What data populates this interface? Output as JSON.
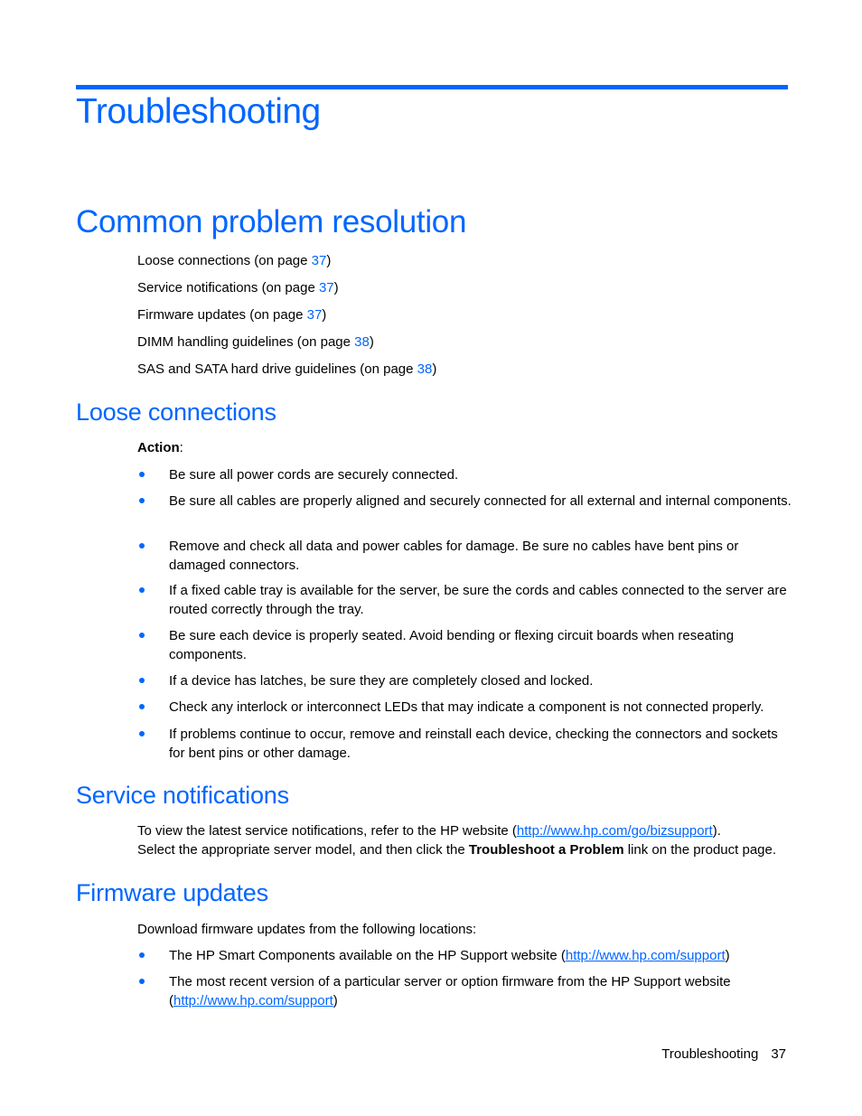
{
  "chapter": {
    "title": "Troubleshooting",
    "accent_color": "#0066ff"
  },
  "section": {
    "title": "Common problem resolution",
    "toc": [
      {
        "label": "Loose connections (on page ",
        "page": "37",
        "suffix": ")"
      },
      {
        "label": "Service notifications (on page ",
        "page": "37",
        "suffix": ")"
      },
      {
        "label": "Firmware updates (on page ",
        "page": "37",
        "suffix": ")"
      },
      {
        "label": "DIMM handling guidelines (on page ",
        "page": "38",
        "suffix": ")"
      },
      {
        "label": "SAS and SATA hard drive guidelines (on page ",
        "page": "38",
        "suffix": ")"
      }
    ]
  },
  "loose_connections": {
    "title": "Loose connections",
    "action_label": "Action",
    "action_colon": ":",
    "bullets": [
      "Be sure all power cords are securely connected.",
      "Be sure all cables are properly aligned and securely connected for all external and internal components.",
      "Remove and check all data and power cables for damage. Be sure no cables have bent pins or damaged connectors.",
      "If a fixed cable tray is available for the server, be sure the cords and cables connected to the server are routed correctly through the tray.",
      "Be sure each device is properly seated. Avoid bending or flexing circuit boards when reseating components.",
      "If a device has latches, be sure they are completely closed and locked.",
      "Check any interlock or interconnect LEDs that may indicate a component is not connected properly.",
      "If problems continue to occur, remove and reinstall each device, checking the connectors and sockets for bent pins or other damage."
    ]
  },
  "service_notifications": {
    "title": "Service notifications",
    "line1_pre": "To view the latest service notifications, refer to the HP website (",
    "line1_link": "http://www.hp.com/go/bizsupport",
    "line1_post": ").",
    "line2_pre": "Select the appropriate server model, and then click the ",
    "line2_bold": "Troubleshoot a Problem",
    "line2_post": " link on the product page."
  },
  "firmware_updates": {
    "title": "Firmware updates",
    "intro": "Download firmware updates from the following locations:",
    "bullets": [
      {
        "pre": "The HP Smart Components available on the HP Support website (",
        "link": "http://www.hp.com/support",
        "post": ")"
      },
      {
        "pre": "The most recent version of a particular server or option firmware from the HP Support website (",
        "link": "http://www.hp.com/support",
        "post": ")"
      }
    ]
  },
  "footer": {
    "section": "Troubleshooting",
    "page": "37"
  }
}
